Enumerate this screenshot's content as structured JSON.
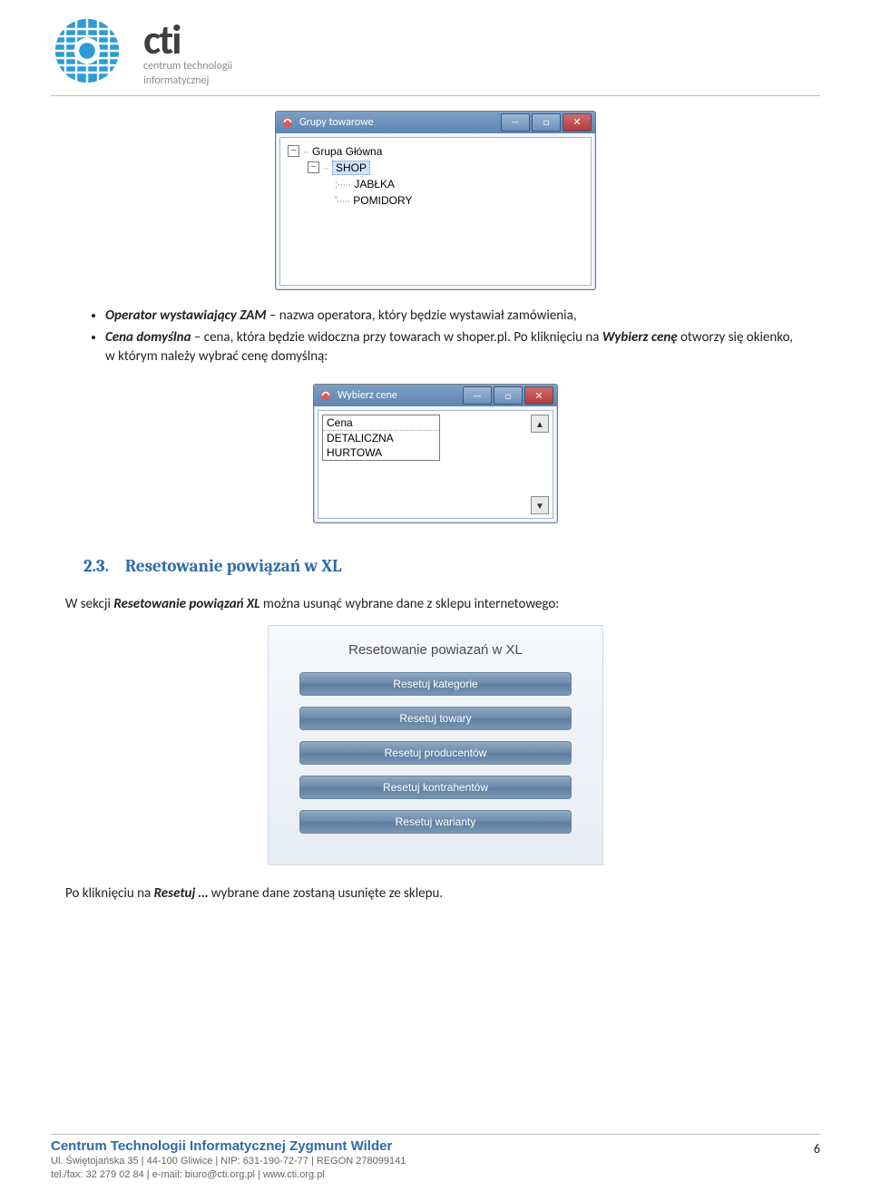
{
  "logo": {
    "word": "cti",
    "sub1": "centrum technologii",
    "sub2": "informatycznej"
  },
  "win_groups": {
    "title": "Grupy towarowe",
    "tree": {
      "root": "Grupa Główna",
      "level1": "SHOP",
      "leaf1": "JABŁKA",
      "leaf2": "POMIDORY"
    }
  },
  "bullets": {
    "b1_label": "Operator wystawiający ZAM",
    "b1_rest": " – nazwa operatora, który będzie wystawiał zamówienia,",
    "b2_label": "Cena domyślna",
    "b2_rest_a": " – cena, która będzie widoczna przy towarach w shoper.pl. Po kliknięciu na ",
    "b2_em": "Wybierz cenę",
    "b2_rest_b": " otworzy się okienko, w którym należy wybrać cenę domyślną:"
  },
  "win_price": {
    "title": "Wybierz cene",
    "opt1": "Cena",
    "opt2": "DETALICZNA",
    "opt3": "HURTOWA"
  },
  "section": {
    "num": "2.3.",
    "title": "Resetowanie powiązań w XL"
  },
  "para1_a": "W sekcji ",
  "para1_em": "Resetowanie powiązań XL",
  "para1_b": " można usunąć wybrane dane z sklepu internetowego:",
  "panel": {
    "title": "Resetowanie powiazań w XL",
    "b1": "Resetuj kategorie",
    "b2": "Resetuj towary",
    "b3": "Resetuj producentów",
    "b4": "Resetuj kontrahentów",
    "b5": "Resetuj warianty"
  },
  "para2_a": "Po kliknięciu na ",
  "para2_em": "Resetuj …",
  "para2_b": " wybrane dane zostaną usunięte ze sklepu.",
  "footer": {
    "title_bold": "Centrum Technologii Informatycznej",
    "title_light": " Zygmunt Wilder",
    "line1": "Ul. Świętojańska 35  |  44-100 Gliwice  |  NIP: 631-190-72-77  |  REGON 278099141",
    "line2": "tel./fax: 32 279 02 84  |  e-mail: biuro@cti.org.pl  |  www.cti.org.pl",
    "page": "6"
  },
  "glyph": {
    "minus": "—",
    "square": "□",
    "x": "✕",
    "up": "▲",
    "down": "▼",
    "box_minus": "−"
  }
}
